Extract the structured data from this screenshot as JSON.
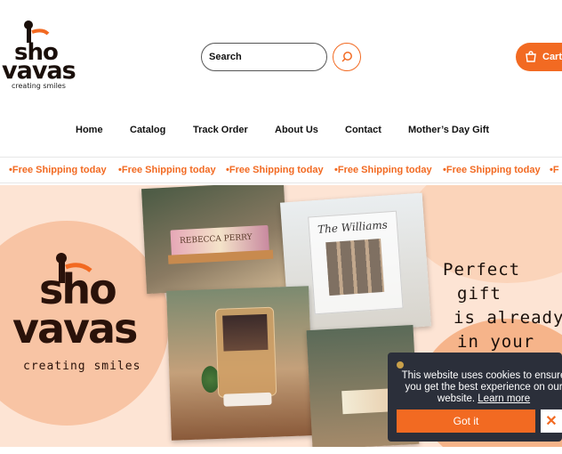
{
  "brand": {
    "logo_word_1": "sho",
    "logo_word_2": "vavas",
    "tagline": "creating smiles"
  },
  "header": {
    "search_placeholder": "Search",
    "cart_label": "Cart",
    "icons": {
      "search": "search-icon",
      "cart": "cart-icon"
    }
  },
  "nav": {
    "items": [
      {
        "label": "Home"
      },
      {
        "label": "Catalog"
      },
      {
        "label": "Track Order"
      },
      {
        "label": "About Us"
      },
      {
        "label": "Contact"
      },
      {
        "label": "Mother’s Day Gift"
      }
    ]
  },
  "ticker": {
    "message": "•Free Shipping today",
    "partial": "•F"
  },
  "hero": {
    "plaque_1_text": "REBECCA PERRY",
    "plaque_2_title": "The Williams",
    "copy_lines": [
      "Perfect",
      "gift",
      "is already",
      "in your"
    ]
  },
  "cookie": {
    "message": "This website uses cookies to ensure you get the best experience on our website.",
    "learn_more": "Learn more",
    "accept_label": "Got it",
    "close_glyph": "✕"
  },
  "colors": {
    "accent": "#f26a22",
    "hero_bg": "#fde4d4",
    "banner_bg": "#2b2f3a",
    "text_dark": "#1a0f0a"
  }
}
